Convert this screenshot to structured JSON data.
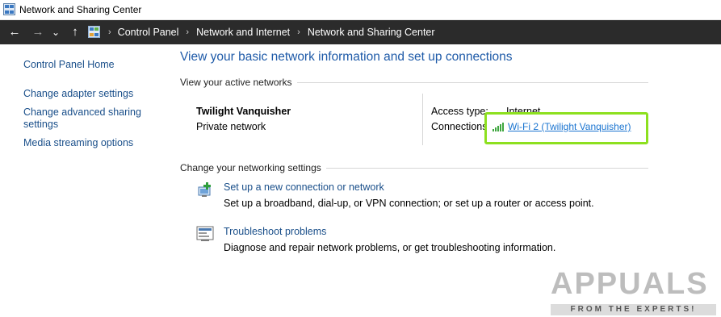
{
  "window": {
    "title": "Network and Sharing Center"
  },
  "navbar": {
    "breadcrumbs": [
      "Control Panel",
      "Network and Internet",
      "Network and Sharing Center"
    ],
    "back_glyph": "←",
    "forward_glyph": "→",
    "recent_glyph": "⌄",
    "up_glyph": "↑",
    "separator": "›"
  },
  "sidebar": {
    "items": [
      {
        "label": "Control Panel Home"
      },
      {
        "label": "Change adapter settings"
      },
      {
        "label": "Change advanced sharing"
      },
      {
        "label": "settings"
      },
      {
        "label": "Media streaming options"
      }
    ]
  },
  "main": {
    "title": "View your basic network information and set up connections",
    "active_networks_label": "View your active networks",
    "network": {
      "name": "Twilight Vanquisher",
      "category": "Private network",
      "access_type_label": "Access type:",
      "access_type_value": "Internet",
      "connections_label": "Connections:",
      "connection_link": "Wi-Fi 2 (Twilight Vanquisher)"
    },
    "change_settings_label": "Change your networking settings",
    "tasks": [
      {
        "link": "Set up a new connection or network",
        "description": "Set up a broadband, dial-up, or VPN connection; or set up a router or access point.",
        "icon": "network-setup-icon"
      },
      {
        "link": "Troubleshoot problems",
        "description": "Diagnose and repair network problems, or get troubleshooting information.",
        "icon": "troubleshoot-icon"
      }
    ]
  },
  "watermark": {
    "text": "APPUALS",
    "subtitle": "FROM THE EXPERTS!"
  },
  "colors": {
    "link": "#1a4f8a",
    "title": "#1e5aa8",
    "highlight": "#8de01f",
    "navbar": "#2b2b2b"
  }
}
